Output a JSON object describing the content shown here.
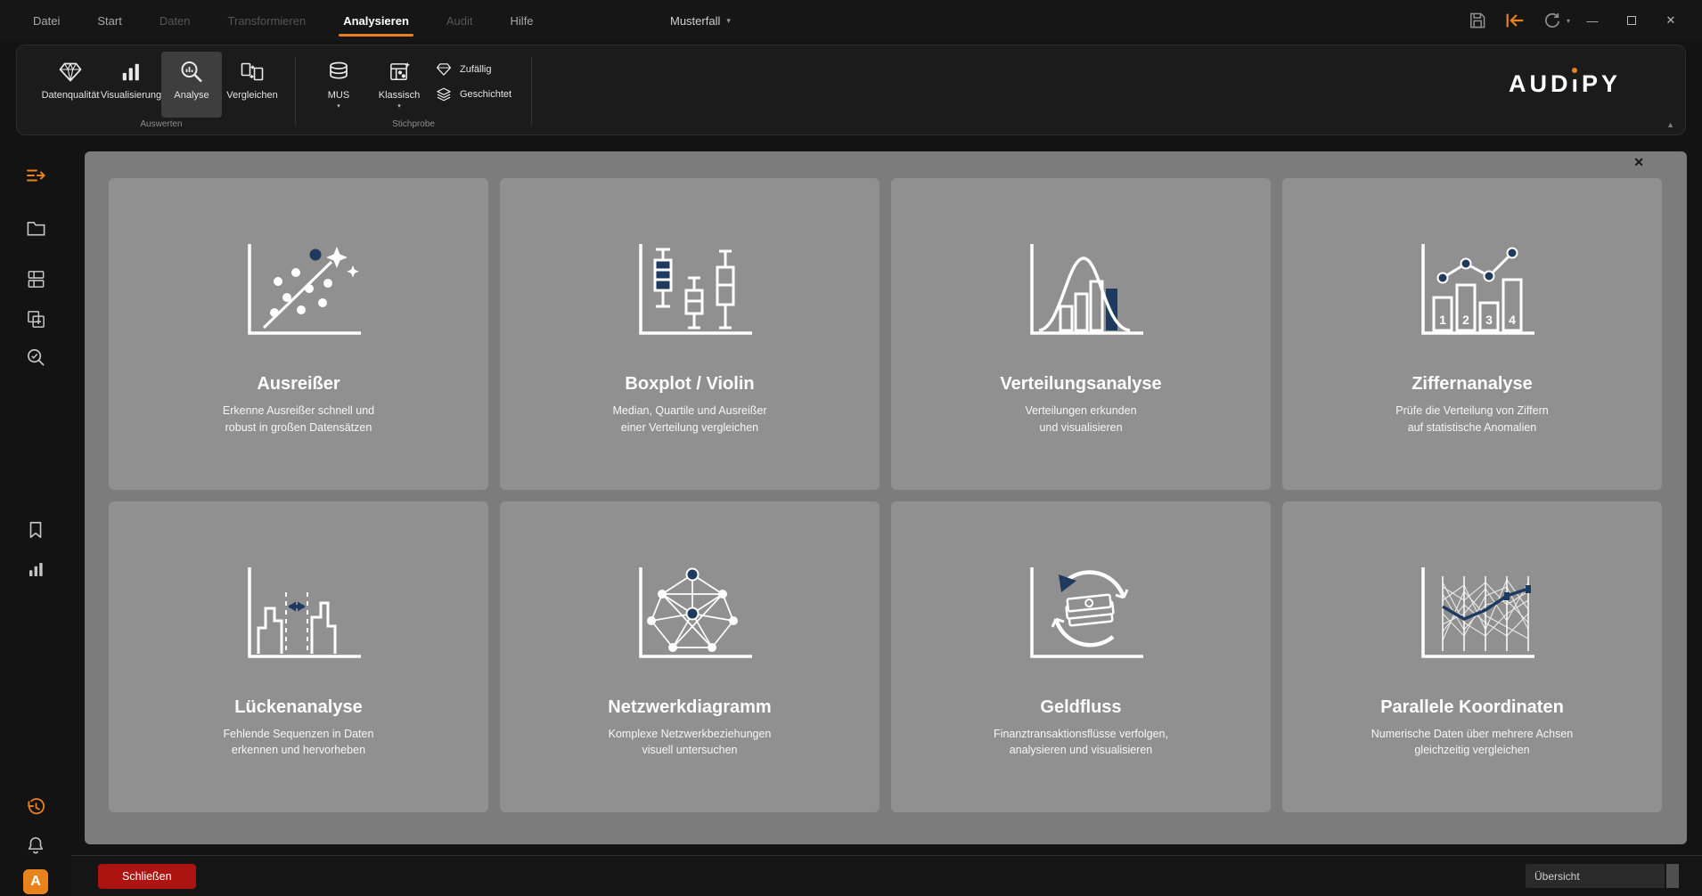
{
  "titlebar": {
    "menu": {
      "datei": "Datei",
      "start": "Start",
      "daten": "Daten",
      "transformieren": "Transformieren",
      "analysieren": "Analysieren",
      "audit": "Audit",
      "hilfe": "Hilfe"
    },
    "case_selector": {
      "label": "Musterfall",
      "caret": "▾"
    },
    "undo_caret": "▾",
    "window": {
      "minimize": "—",
      "close": "✕"
    }
  },
  "ribbon": {
    "buttons": {
      "datenqualitaet": "Datenqualität",
      "visualisierung": "Visualisierung",
      "analyse": "Analyse",
      "vergleichen": "Vergleichen",
      "mus": "MUS",
      "klassisch": "Klassisch",
      "zufaellig": "Zufällig",
      "geschichtet": "Geschichtet"
    },
    "caret": "▾",
    "group_labels": {
      "auswerten": "Auswerten",
      "stichprobe": "Stichprobe"
    },
    "logo": {
      "left": "AUD",
      "mid": "ı",
      "right": "PY"
    },
    "collapse_glyph": "▲"
  },
  "sidebar": {
    "logo_text": "A"
  },
  "panel": {
    "close_glyph": "✕"
  },
  "cards": [
    {
      "title": "Ausreißer",
      "subtitle": "Erkenne Ausreißer schnell und\nrobust in großen Datensätzen"
    },
    {
      "title": "Boxplot / Violin",
      "subtitle": "Median, Quartile und Ausreißer\neiner Verteilung vergleichen"
    },
    {
      "title": "Verteilungsanalyse",
      "subtitle": "Verteilungen erkunden\nund visualisieren"
    },
    {
      "title": "Ziffernanalyse",
      "subtitle": "Prüfe die Verteilung von Ziffern\nauf statistische Anomalien",
      "digits": [
        "1",
        "2",
        "3",
        "4"
      ]
    },
    {
      "title": "Lückenanalyse",
      "subtitle": "Fehlende Sequenzen in Daten\nerkennen und hervorheben"
    },
    {
      "title": "Netzwerkdiagramm",
      "subtitle": "Komplexe Netzwerkbeziehungen\nvisuell untersuchen"
    },
    {
      "title": "Geldfluss",
      "subtitle": "Finanztransaktionsflüsse verfolgen,\nanalysieren und visualisieren"
    },
    {
      "title": "Parallele Koordinaten",
      "subtitle": "Numerische Daten über mehrere Achsen\ngleichzeitig vergleichen"
    }
  ],
  "bottombar": {
    "close_button": "Schließen",
    "status_value": "Übersicht"
  },
  "colors": {
    "accent_orange": "#E8821C",
    "accent_navy": "#1E3A5F",
    "danger_red": "#AD1411",
    "card_gray": "#909090",
    "panel_gray": "#7C7C7C"
  }
}
